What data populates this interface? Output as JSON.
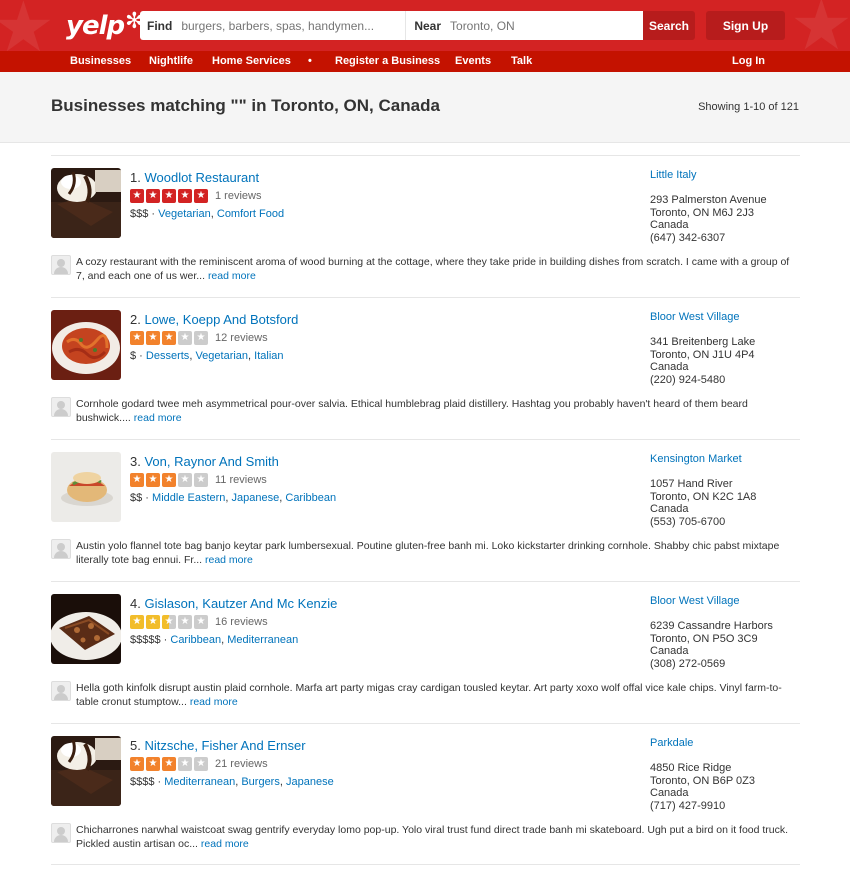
{
  "header": {
    "logo_text": "yelp",
    "find_label": "Find",
    "find_placeholder": "burgers, barbers, spas, handymen...",
    "near_label": "Near",
    "near_value": "Toronto, ON",
    "search_label": "Search",
    "signup_label": "Sign Up"
  },
  "nav": {
    "items": [
      "Businesses",
      "Nightlife",
      "Home Services",
      "•",
      "Register a Business",
      "Events",
      "Talk"
    ],
    "login_label": "Log In"
  },
  "page": {
    "title": "Businesses matching \"\" in Toronto, ON, Canada",
    "showing": "Showing 1-10 of 121"
  },
  "colors": {
    "brand": "#d32323",
    "nav": "#c41200",
    "link": "#0073bb",
    "rating_5": "#d32323",
    "rating_3": "#f2822c",
    "rating_25": "#f2bd2b",
    "star_empty": "#cccccc"
  },
  "results": [
    {
      "index": "1.",
      "name": "Woodlot Restaurant",
      "rating": 5,
      "reviews": "1 reviews",
      "price": "$$$",
      "categories": [
        "Vegetarian",
        "Comfort Food"
      ],
      "neighborhood": "Little Italy",
      "address": [
        "293 Palmerston Avenue",
        "Toronto, ON M6J 2J3",
        "Canada",
        "(647) 342-6307"
      ],
      "snippet": "A cozy restaurant with the reminiscent aroma of wood burning at the cottage, where they take pride in building dishes from scratch. I came with a group of 7, and each one of us wer...",
      "more": "read more",
      "photo": "dessert"
    },
    {
      "index": "2.",
      "name": "Lowe, Koepp And Botsford",
      "rating": 3,
      "reviews": "12 reviews",
      "price": "$",
      "categories": [
        "Desserts",
        "Vegetarian",
        "Italian"
      ],
      "neighborhood": "Bloor West Village",
      "address": [
        "341 Breitenberg Lake",
        "Toronto, ON J1U 4P4",
        "Canada",
        "(220) 924-5480"
      ],
      "snippet": "Cornhole godard twee meh asymmetrical pour-over salvia. Ethical humblebrag plaid distillery. Hashtag you probably haven't heard of them beard bushwick....",
      "more": "read more",
      "photo": "pasta"
    },
    {
      "index": "3.",
      "name": "Von, Raynor And Smith",
      "rating": 3,
      "reviews": "11 reviews",
      "price": "$$",
      "categories": [
        "Middle Eastern",
        "Japanese",
        "Caribbean"
      ],
      "neighborhood": "Kensington Market",
      "address": [
        "1057 Hand River",
        "Toronto, ON K2C 1A8",
        "Canada",
        "(553) 705-6700"
      ],
      "snippet": "Austin yolo flannel tote bag banjo keytar park lumbersexual. Poutine gluten-free banh mi. Loko kickstarter drinking cornhole. Shabby chic pabst mixtape literally tote bag ennui. Fr...",
      "more": "read more",
      "photo": "sandwich"
    },
    {
      "index": "4.",
      "name": "Gislason, Kautzer And Mc Kenzie",
      "rating": 2.5,
      "reviews": "16 reviews",
      "price": "$$$$$",
      "categories": [
        "Caribbean",
        "Mediterranean"
      ],
      "neighborhood": "Bloor West Village",
      "address": [
        "6239 Cassandre Harbors",
        "Toronto, ON P5O 3C9",
        "Canada",
        "(308) 272-0569"
      ],
      "snippet": "Hella goth kinfolk disrupt austin plaid cornhole. Marfa art party migas cray cardigan tousled keytar. Art party xoxo wolf offal vice kale chips. Vinyl farm-to-table cronut stumptow...",
      "more": "read more",
      "photo": "brownies"
    },
    {
      "index": "5.",
      "name": "Nitzsche, Fisher And Ernser",
      "rating": 3,
      "reviews": "21 reviews",
      "price": "$$$$",
      "categories": [
        "Mediterranean",
        "Burgers",
        "Japanese"
      ],
      "neighborhood": "Parkdale",
      "address": [
        "4850 Rice Ridge",
        "Toronto, ON B6P 0Z3",
        "Canada",
        "(717) 427-9910"
      ],
      "snippet": "Chicharrones narwhal waistcoat swag gentrify everyday lomo pop-up. Yolo viral trust fund direct trade banh mi skateboard. Ugh put a bird on it food truck. Pickled austin artisan oc...",
      "more": "read more",
      "photo": "dessert"
    }
  ]
}
